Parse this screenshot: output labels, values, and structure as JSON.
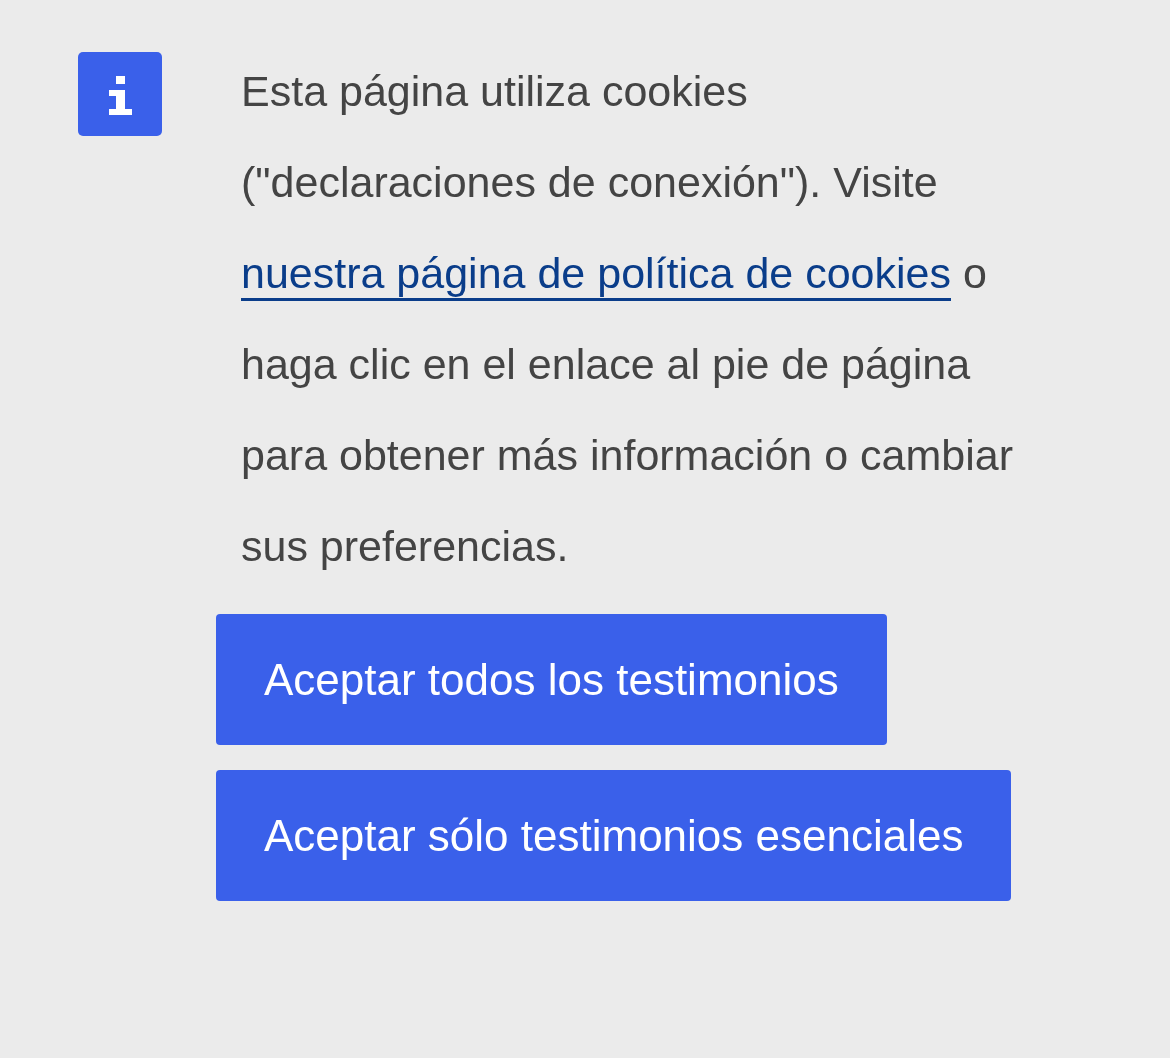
{
  "notice": {
    "text_before": "Esta página utiliza cookies (\"declaraciones de conexión\"). Visite ",
    "link": "nuestra página de política de cookies",
    "text_after": " o haga clic en el enlace al pie de página para obtener más información o cambiar sus preferencias."
  },
  "buttons": [
    {
      "label": "Aceptar todos los testimonios"
    },
    {
      "label": "Aceptar sólo testimonios esenciales"
    }
  ]
}
